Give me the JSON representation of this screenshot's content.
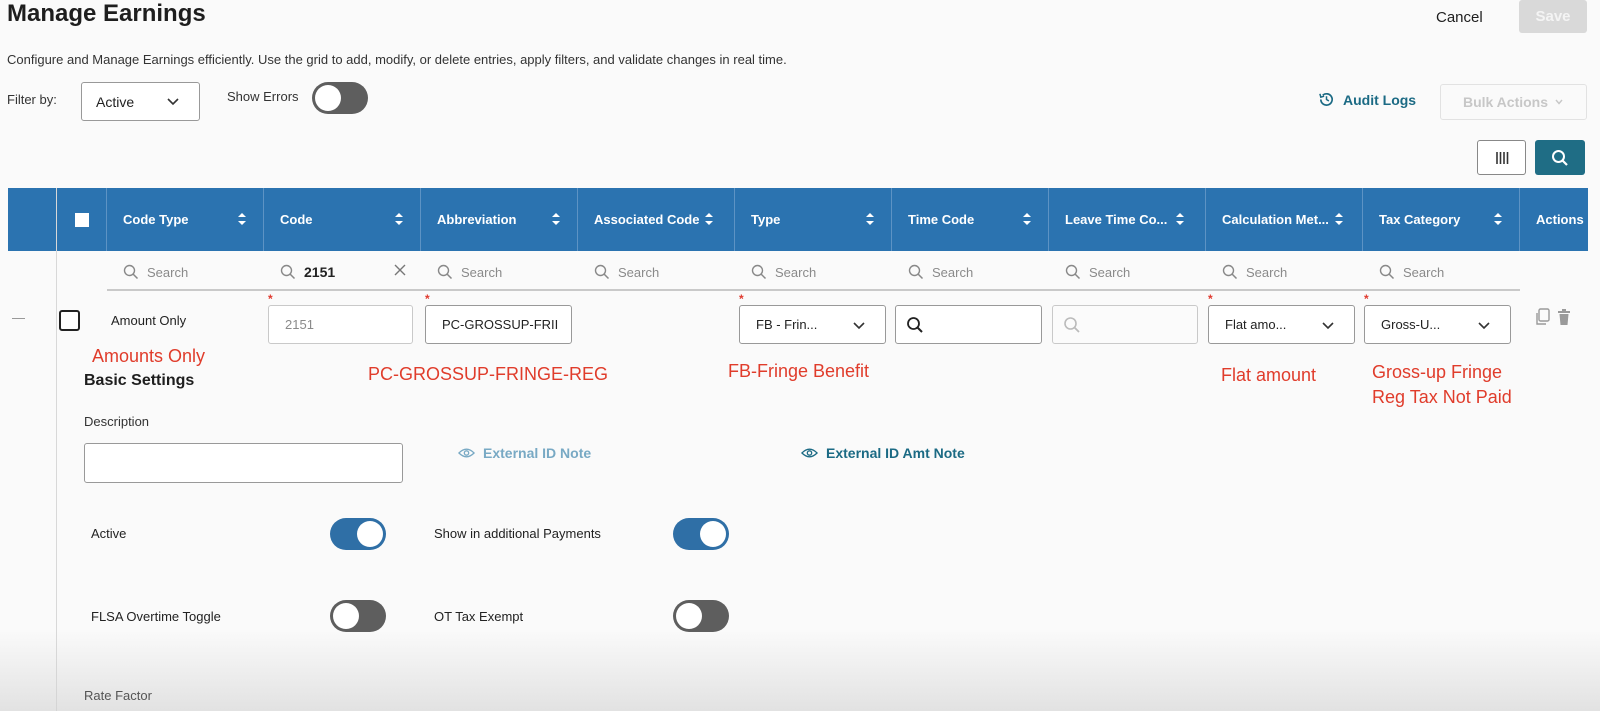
{
  "header": {
    "title": "Manage Earnings",
    "cancel_label": "Cancel",
    "save_label": "Save",
    "subtitle": "Configure and Manage Earnings efficiently. Use the grid to add, modify, or delete entries, apply filters, and validate changes in real time."
  },
  "filters": {
    "filter_label": "Filter by:",
    "filter_value": "Active",
    "show_errors_label": "Show Errors",
    "show_errors_on": false
  },
  "toolbar": {
    "audit_logs_label": "Audit Logs",
    "bulk_actions_label": "Bulk Actions"
  },
  "grid": {
    "columns": [
      "Code Type",
      "Code",
      "Abbreviation",
      "Associated Code",
      "Type",
      "Time Code",
      "Leave Time Co...",
      "Calculation Met...",
      "Tax Category",
      "Actions"
    ],
    "search_placeholder": "Search",
    "code_search_value": "2151",
    "row": {
      "code_type": "Amount Only",
      "code": "2151",
      "abbreviation": "PC-GROSSUP-FRII",
      "type": "FB - Frin...",
      "calculation_method": "Flat amo...",
      "tax_category": "Gross-U..."
    }
  },
  "annotations": {
    "code_type_full": "Amounts Only",
    "abbreviation_full": "PC-GROSSUP-FRINGE-REG",
    "type_full": "FB-Fringe Benefit",
    "calc_full": "Flat amount",
    "tax_line1": "Gross-up Fringe",
    "tax_line2": "Reg Tax Not Paid"
  },
  "details": {
    "section_title": "Basic Settings",
    "description_label": "Description",
    "description_value": "",
    "external_id_note": "External ID Note",
    "external_id_amt_note": "External ID Amt Note",
    "active_label": "Active",
    "active_on": true,
    "show_additional_label": "Show in additional Payments",
    "show_additional_on": true,
    "flsa_label": "FLSA Overtime Toggle",
    "flsa_on": false,
    "ot_tax_label": "OT Tax Exempt",
    "ot_tax_on": false,
    "rate_factor_label": "Rate Factor"
  },
  "colors": {
    "header_blue": "#2b73b0",
    "accent_teal": "#1f6d85",
    "annotation_red": "#e03c2b"
  }
}
